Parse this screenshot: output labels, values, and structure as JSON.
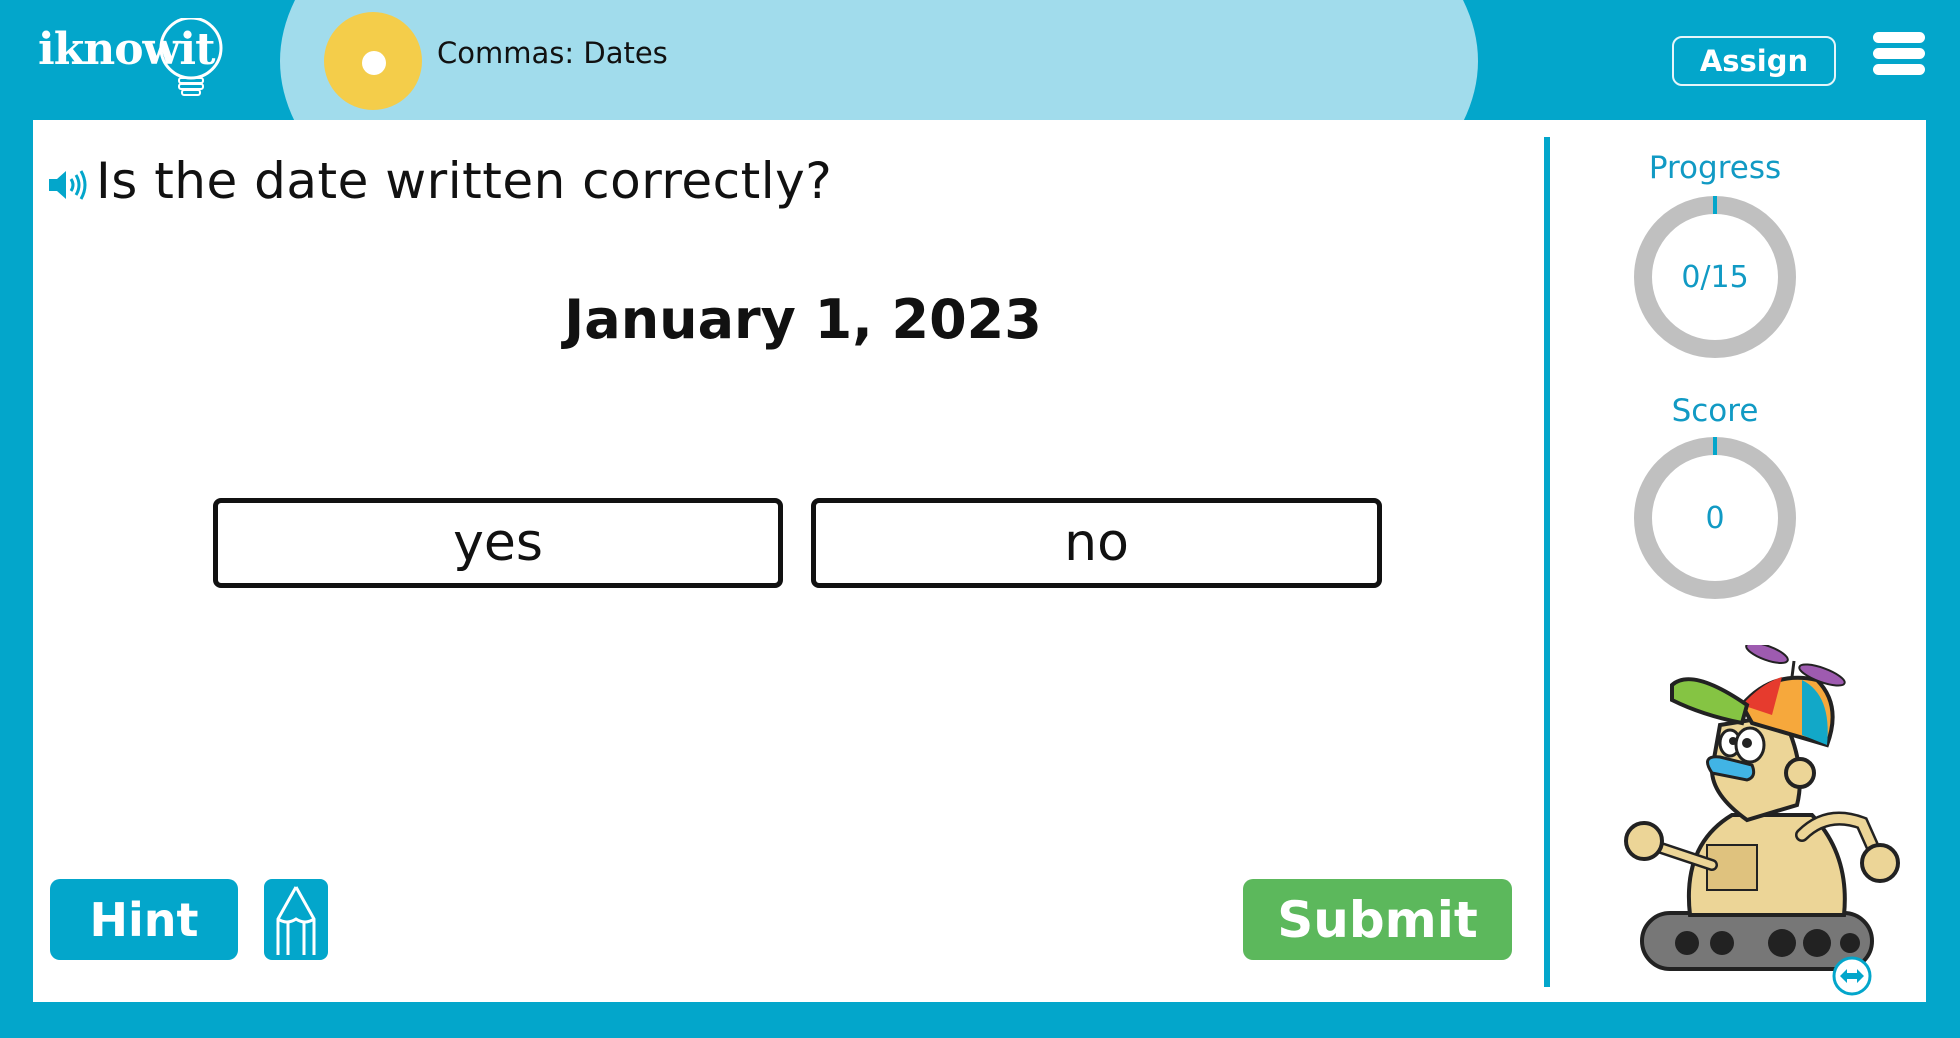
{
  "app": {
    "logo_text": "iknowit",
    "lesson_title": "Commas: Dates",
    "assign_label": "Assign",
    "menu_icon": "hamburger-menu-icon"
  },
  "question": {
    "speaker_icon": "speaker-icon",
    "text": "Is the date written correctly?",
    "prompt": "January 1, 2023",
    "answers": [
      {
        "label": "yes"
      },
      {
        "label": "no"
      }
    ]
  },
  "actions": {
    "hint_label": "Hint",
    "pencil_icon": "pencil-icon",
    "submit_label": "Submit"
  },
  "sidebar": {
    "progress": {
      "label": "Progress",
      "value_text": "0/15",
      "completed": 0,
      "total": 15
    },
    "score": {
      "label": "Score",
      "value_text": "0",
      "value": 0
    },
    "mascot": "robot-mascot",
    "swap_icon": "swap-horizontal-icon"
  },
  "colors": {
    "brand_blue": "#03a6cb",
    "banner_light_blue": "#a1dcec",
    "badge_yellow": "#f4cd4a",
    "submit_green": "#5cb85c",
    "gauge_gray": "#c0c0c0",
    "gauge_text_blue": "#119ac4"
  }
}
